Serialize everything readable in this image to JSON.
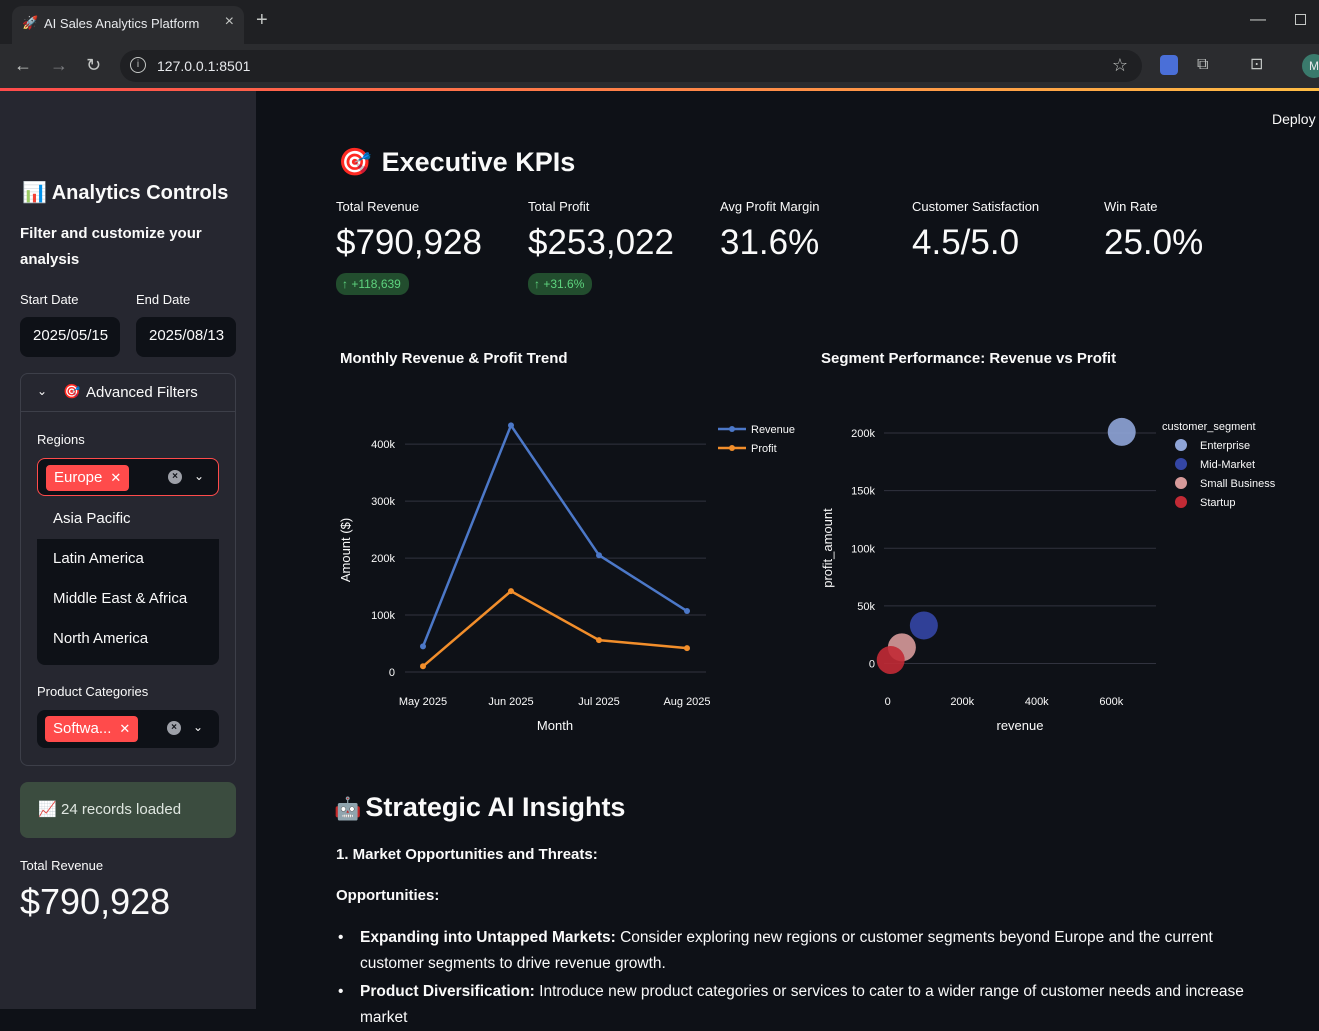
{
  "browser": {
    "tab_title": "AI Sales Analytics Platform",
    "tab_icon": "🚀",
    "url": "127.0.0.1:8501",
    "profile_initial": "M"
  },
  "app": {
    "deploy_label": "Deploy"
  },
  "sidebar": {
    "title_icon": "📊",
    "title": "Analytics Controls",
    "subtitle": "Filter and customize your analysis",
    "start_date_label": "Start Date",
    "start_date": "2025/05/15",
    "end_date_label": "End Date",
    "end_date": "2025/08/13",
    "expander": {
      "icon": "🎯",
      "label": "Advanced Filters",
      "regions_label": "Regions",
      "regions_selected": "Europe",
      "region_options": [
        "Asia Pacific",
        "Latin America",
        "Middle East & Africa",
        "North America"
      ],
      "categories_label": "Product Categories",
      "categories_selected": "Softwa..."
    },
    "records_icon": "📈",
    "records_text": "24 records loaded",
    "metric_label": "Total Revenue",
    "metric_value": "$790,928"
  },
  "kpis": {
    "title_icon": "🎯",
    "title": "Executive KPIs",
    "items": [
      {
        "label": "Total Revenue",
        "value": "$790,928",
        "delta": "+118,639"
      },
      {
        "label": "Total Profit",
        "value": "$253,022",
        "delta": "+31.6%"
      },
      {
        "label": "Avg Profit Margin",
        "value": "31.6%",
        "delta": null
      },
      {
        "label": "Customer Satisfaction",
        "value": "4.5/5.0",
        "delta": null
      },
      {
        "label": "Win Rate",
        "value": "25.0%",
        "delta": null
      }
    ]
  },
  "chart_data": [
    {
      "type": "line",
      "title": "Monthly Revenue & Profit Trend",
      "xlabel": "Month",
      "ylabel": "Amount ($)",
      "categories": [
        "May 2025",
        "Jun 2025",
        "Jul 2025",
        "Aug 2025"
      ],
      "yticks": [
        "0",
        "100k",
        "200k",
        "300k",
        "400k"
      ],
      "ylim": [
        0,
        460000
      ],
      "series": [
        {
          "name": "Revenue",
          "color": "#4c78c8",
          "values": [
            45000,
            433000,
            205000,
            107000
          ]
        },
        {
          "name": "Profit",
          "color": "#f28e2b",
          "values": [
            10000,
            142000,
            56000,
            42000
          ]
        }
      ],
      "legend": "top-right",
      "grid": true
    },
    {
      "type": "scatter",
      "title": "Segment Performance: Revenue vs Profit",
      "xlabel": "revenue",
      "ylabel": "profit_amount",
      "xticks": [
        "0",
        "200k",
        "400k",
        "600k"
      ],
      "yticks": [
        "0",
        "50k",
        "100k",
        "150k",
        "200k"
      ],
      "xlim": [
        -10000,
        720000
      ],
      "ylim": [
        -10000,
        220000
      ],
      "legend_title": "customer_segment",
      "legend": "top-right",
      "series": [
        {
          "name": "Enterprise",
          "color": "#8fa5d8",
          "x": 628000,
          "y": 201000,
          "size": 14
        },
        {
          "name": "Mid-Market",
          "color": "#3446a5",
          "x": 97000,
          "y": 33000,
          "size": 14
        },
        {
          "name": "Small Business",
          "color": "#d79a9a",
          "x": 38000,
          "y": 14000,
          "size": 14
        },
        {
          "name": "Startup",
          "color": "#c22a35",
          "x": 8000,
          "y": 3000,
          "size": 14
        }
      ]
    }
  ],
  "insights": {
    "title_icon": "🤖",
    "title": "Strategic AI Insights",
    "heading1": "1. Market Opportunities and Threats:",
    "heading2": "Opportunities:",
    "bullets": [
      {
        "bold": "Expanding into Untapped Markets:",
        "text": " Consider exploring new regions or customer segments beyond Europe and the current customer segments to drive revenue growth."
      },
      {
        "bold": "Product Diversification:",
        "text": " Introduce new product categories or services to cater to a wider range of customer needs and increase market"
      }
    ]
  },
  "colors": {
    "accent": "#ff4b4b",
    "background": "#0e1117",
    "sidebar": "#262730",
    "success_bg": "#224d2e",
    "success_text": "#5ed37e"
  }
}
